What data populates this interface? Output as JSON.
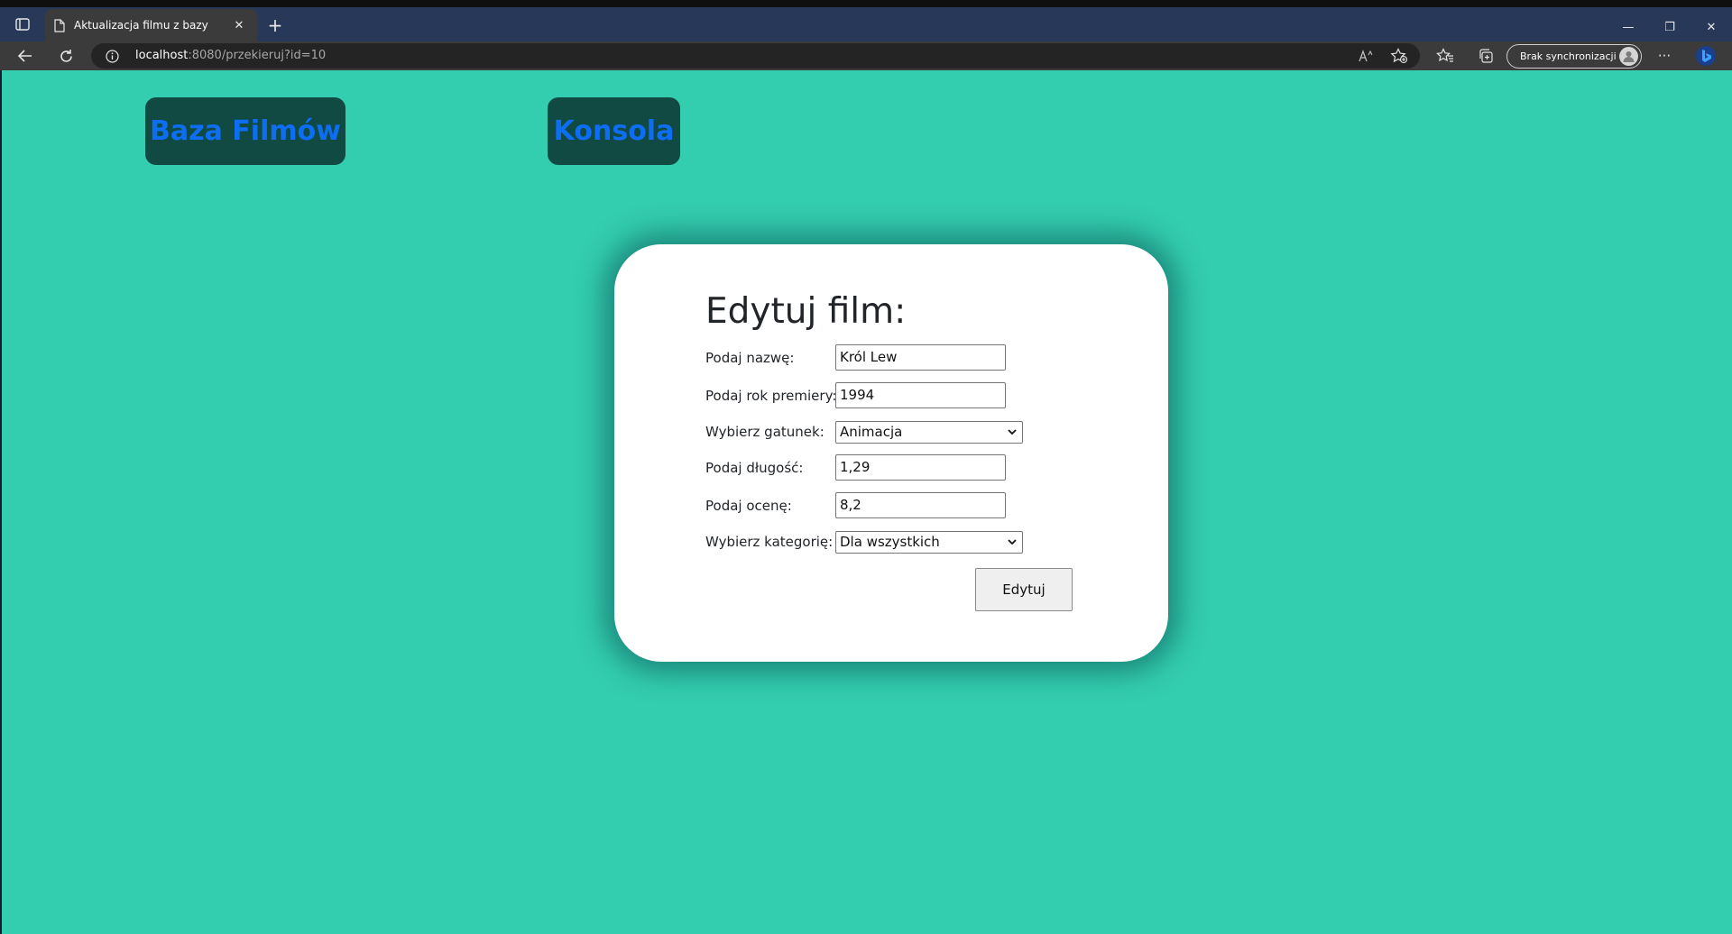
{
  "browser": {
    "tab_title": "Aktualizacja filmu z bazy",
    "tab_close": "✕",
    "new_tab": "+",
    "win_minimize": "—",
    "win_restore": "❐",
    "win_close": "✕",
    "url_host": "localhost",
    "url_rest": ":8080/przekieruj?id=10",
    "sync_label": "Brak synchronizacji",
    "more_label": "···"
  },
  "nav": {
    "baza_label": "Baza Filmów",
    "konsola_label": "Konsola",
    "button_bg": "#114a42",
    "button_text_color": "#0d6ef4"
  },
  "form": {
    "title": "Edytuj film:",
    "name_label": "Podaj nazwę:",
    "name_value": "Król Lew",
    "year_label": "Podaj rok premiery:",
    "year_value": "1994",
    "genre_label": "Wybierz gatunek:",
    "genre_value": "Animacja",
    "length_label": "Podaj długość:",
    "length_value": "1,29",
    "rating_label": "Podaj ocenę:",
    "rating_value": "8,2",
    "category_label": "Wybierz kategorię:",
    "category_value": "Dla wszystkich",
    "submit_label": "Edytuj"
  },
  "colors": {
    "page_bg": "#33cdb0",
    "card_bg": "#ffffff"
  }
}
